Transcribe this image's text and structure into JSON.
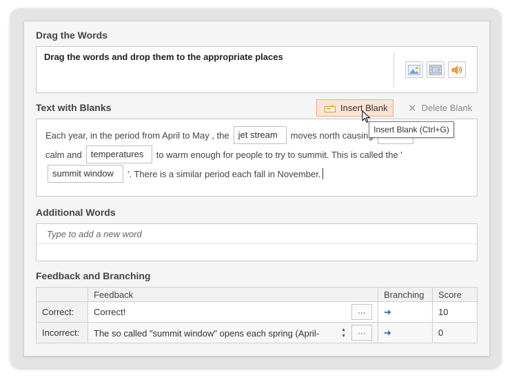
{
  "drag_words": {
    "title": "Drag the Words",
    "instruction": "Drag the words and drop them to the appropriate places",
    "media_icons": [
      "image-icon",
      "video-icon",
      "audio-icon"
    ]
  },
  "text_blanks": {
    "title": "Text with Blanks",
    "insert_label": "Insert Blank",
    "delete_label": "Delete Blank",
    "tooltip": "Insert Blank (Ctrl+G)",
    "line1_a": "Each year, in the period from April to May , the",
    "blank1": "jet stream",
    "line1_b": "moves north causing",
    "line2_a": "calm and",
    "blank3": "temperatures",
    "line2_b": "to warm enough for people to try to summit. This is called the '",
    "blank4": "summit window",
    "line3_b": "'. There is a similar period each fall in November."
  },
  "additional_words": {
    "title": "Additional Words",
    "placeholder": "Type to add a new word"
  },
  "feedback": {
    "title": "Feedback and Branching",
    "headers": {
      "feedback": "Feedback",
      "branching": "Branching",
      "score": "Score"
    },
    "rows": [
      {
        "label": "Correct:",
        "text": "Correct!",
        "score": "10"
      },
      {
        "label": "Incorrect:",
        "text": "The so called \"summit window\" opens each spring (April-",
        "score": "0"
      }
    ],
    "ellipsis": "···",
    "branch_arrow": "➔"
  },
  "colors": {
    "insert_bg": "#fde4d7",
    "insert_border": "#f0a886",
    "arrow": "#2a5aa0"
  }
}
